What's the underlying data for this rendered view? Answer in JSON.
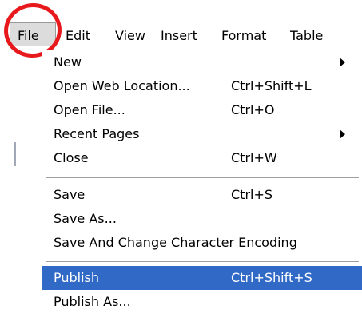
{
  "menubar": {
    "items": [
      "File",
      "Edit",
      "View",
      "Insert",
      "Format",
      "Table"
    ]
  },
  "file_menu": {
    "items": [
      {
        "label": "New",
        "shortcut": "",
        "submenu": true
      },
      {
        "label": "Open Web Location...",
        "shortcut": "Ctrl+Shift+L",
        "submenu": false
      },
      {
        "label": "Open File...",
        "shortcut": "Ctrl+O",
        "submenu": false
      },
      {
        "label": "Recent Pages",
        "shortcut": "",
        "submenu": true
      },
      {
        "label": "Close",
        "shortcut": "Ctrl+W",
        "submenu": false
      },
      {
        "label": "Save",
        "shortcut": "Ctrl+S",
        "submenu": false
      },
      {
        "label": "Save As...",
        "shortcut": "",
        "submenu": false
      },
      {
        "label": "Save And Change Character Encoding",
        "shortcut": "",
        "submenu": false
      },
      {
        "label": "Publish",
        "shortcut": "Ctrl+Shift+S",
        "submenu": false,
        "selected": true
      },
      {
        "label": "Publish As...",
        "shortcut": "",
        "submenu": false
      }
    ]
  },
  "colors": {
    "highlight": "#3169c6",
    "annotation_circle": "#e8191c"
  }
}
